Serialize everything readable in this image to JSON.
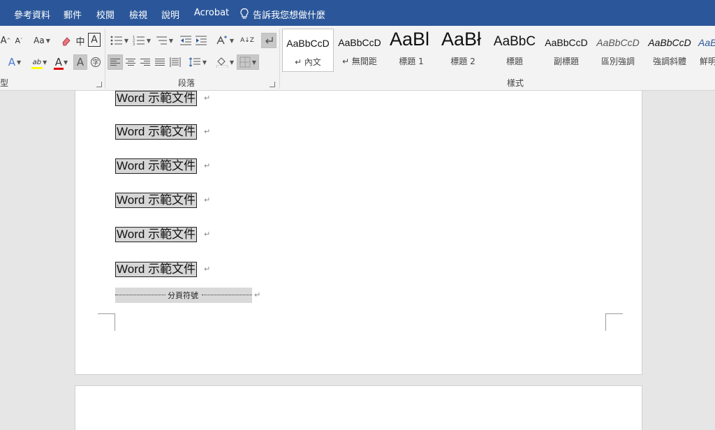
{
  "tabs": [
    "參考資料",
    "郵件",
    "校閱",
    "檢視",
    "說明",
    "Acrobat"
  ],
  "tell_me": "告訴我您想做什麼",
  "ribbon": {
    "font_group_label": "型",
    "paragraph_group_label": "段落",
    "styles_group_label": "樣式",
    "font_size_change_label": "Aa",
    "phonetic_label": "中",
    "char_border_label": "A",
    "text_effect_label": "A",
    "highlight_label": "ab",
    "font_color_label": "A",
    "char_shading_label": "A",
    "sort_label": "A↓Z"
  },
  "styles": [
    {
      "preview": "AaBbCcD",
      "name": "↵ 內文",
      "active": true
    },
    {
      "preview": "AaBbCcD",
      "name": "↵ 無間距",
      "active": false
    },
    {
      "preview": "AaBl",
      "name": "標題 1",
      "active": false
    },
    {
      "preview": "AaBł",
      "name": "標題 2",
      "active": false
    },
    {
      "preview": "AaBbC",
      "name": "標題",
      "active": false
    },
    {
      "preview": "AaBbCcD",
      "name": "副標題",
      "active": false
    },
    {
      "preview": "AaBbCcD",
      "name": "區別強調",
      "active": false
    },
    {
      "preview": "AaBbCcD",
      "name": "強調斜體",
      "active": false
    },
    {
      "preview": "AaB",
      "name": "鮮明",
      "active": false
    }
  ],
  "document": {
    "lines": [
      "Word 示範文件",
      "Word 示範文件",
      "Word 示範文件",
      "Word 示範文件",
      "Word 示範文件",
      "Word 示範文件"
    ],
    "paragraph_mark": "↵",
    "page_break_label": "分頁符號"
  },
  "colors": {
    "tab_bar": "#2b579a",
    "ribbon_bg": "#f3f3f3",
    "highlight_yellow": "#ffff00",
    "font_color_red": "#e00000"
  }
}
